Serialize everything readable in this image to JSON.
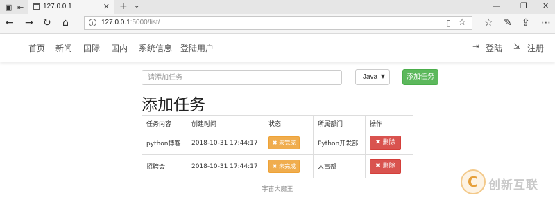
{
  "browser": {
    "tab_title": "127.0.0.1",
    "tab_close": "✕",
    "new_tab": "+",
    "tab_menu": "⌄",
    "window_controls": {
      "minimize": "—",
      "restore": "❐",
      "close": "✕"
    },
    "url_host": "127.0.0.1",
    "url_path": ":5000/list/",
    "info_icon": "i"
  },
  "sitenav": {
    "items": [
      "首页",
      "新闻",
      "国际",
      "国内",
      "系统信息",
      "登陆用户"
    ],
    "login_label": "登陆",
    "register_label": "注册"
  },
  "form": {
    "task_placeholder": "请添加任务",
    "select_value": "Java",
    "add_button": "添加任务"
  },
  "page_title": "添加任务",
  "table": {
    "headers": [
      "任务内容",
      "创建时间",
      "状态",
      "所属部门",
      "操作"
    ],
    "rows": [
      {
        "content": "python博客",
        "created": "2018-10-31 17:44:17",
        "status": "未完成",
        "department": "Python开发部",
        "action": "删除"
      },
      {
        "content": "招聘会",
        "created": "2018-10-31 17:44:17",
        "status": "未完成",
        "department": "人事部",
        "action": "删除"
      }
    ]
  },
  "footer": "宇宙大魔王",
  "watermark": {
    "mark": "C",
    "text": "创新互联"
  },
  "colors": {
    "success": "#5cb85c",
    "warning": "#f0ad4e",
    "danger": "#d9534f"
  }
}
